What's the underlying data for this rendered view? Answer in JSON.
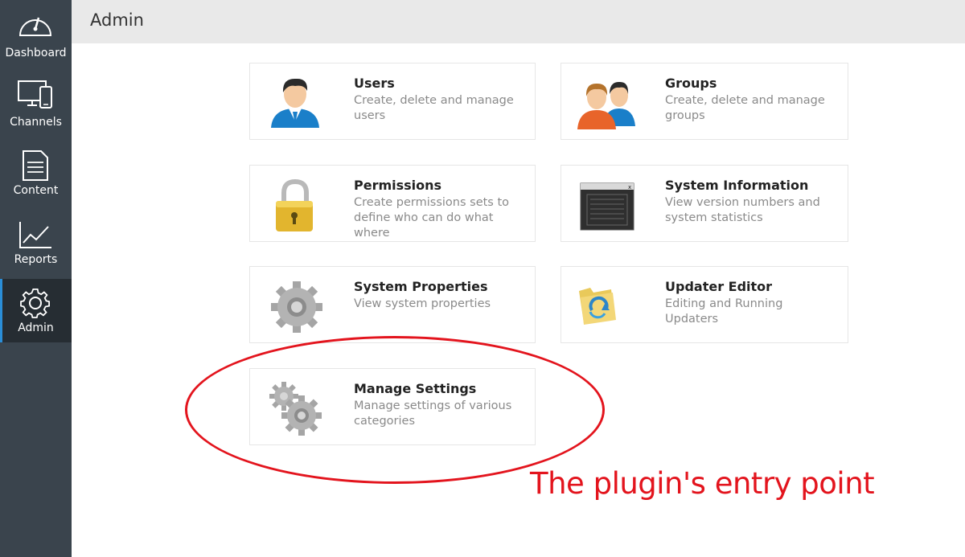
{
  "sidebar": {
    "items": [
      {
        "label": "Dashboard",
        "icon": "dashboard-gauge-icon"
      },
      {
        "label": "Channels",
        "icon": "monitor-phone-icon"
      },
      {
        "label": "Content",
        "icon": "document-icon"
      },
      {
        "label": "Reports",
        "icon": "line-chart-icon"
      },
      {
        "label": "Admin",
        "icon": "gear-icon",
        "active": true
      }
    ]
  },
  "header": {
    "title": "Admin"
  },
  "cards": {
    "users": {
      "title": "Users",
      "description": "Create, delete and manage users"
    },
    "groups": {
      "title": "Groups",
      "description": "Create, delete and manage groups"
    },
    "permissions": {
      "title": "Permissions",
      "description": "Create permissions sets to define who can do what where"
    },
    "system_information": {
      "title": "System Information",
      "description": "View version numbers and system statistics"
    },
    "system_properties": {
      "title": "System Properties",
      "description": "View system properties"
    },
    "updater_editor": {
      "title": "Updater Editor",
      "description": "Editing and Running Updaters"
    },
    "manage_settings": {
      "title": "Manage Settings",
      "description": "Manage settings of various categories"
    }
  },
  "annotation": {
    "text": "The plugin's entry point",
    "color": "#e3141d"
  },
  "colors": {
    "sidebar": "#3a444d",
    "sidebar_active": "#262d33",
    "accent": "#2a8ed8",
    "header": "#e9e9e9"
  }
}
